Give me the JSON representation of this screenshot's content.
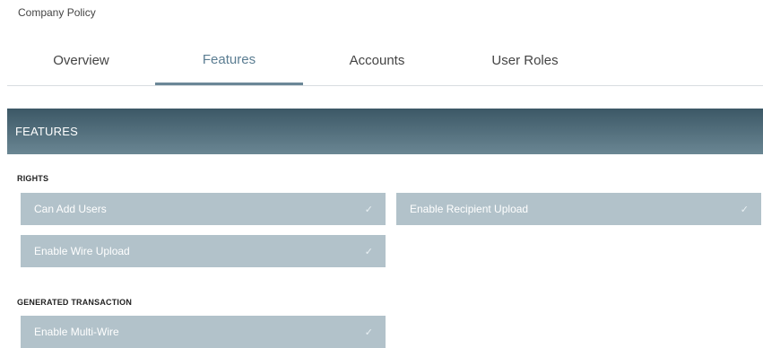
{
  "breadcrumb": "Company Policy",
  "tabs": [
    {
      "label": "Overview",
      "active": false
    },
    {
      "label": "Features",
      "active": true
    },
    {
      "label": "Accounts",
      "active": false
    },
    {
      "label": "User Roles",
      "active": false
    }
  ],
  "section": {
    "title": "FEATURES"
  },
  "groups": {
    "rights": {
      "title": "RIGHTS",
      "items": [
        {
          "label": "Can Add Users",
          "checked": true
        },
        {
          "label": "Enable Recipient Upload",
          "checked": true
        },
        {
          "label": "Enable Wire Upload",
          "checked": true
        }
      ]
    },
    "generated_transaction": {
      "title": "GENERATED TRANSACTION",
      "items": [
        {
          "label": "Enable Multi-Wire",
          "checked": true
        }
      ]
    }
  },
  "icons": {
    "check": "✓"
  },
  "colors": {
    "accent": "#5b7d92",
    "header_dark": "#3c5866",
    "header_light": "#6a8693",
    "toggle_bg": "#b2c2ca"
  }
}
